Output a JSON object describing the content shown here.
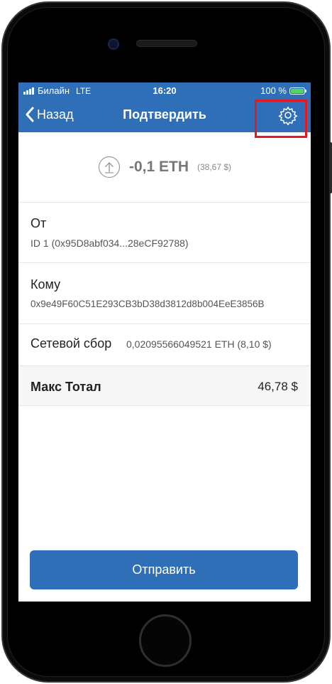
{
  "status_bar": {
    "carrier": "Билайн",
    "network": "LTE",
    "time": "16:20",
    "battery_percent": "100 %"
  },
  "nav": {
    "back_label": "Назад",
    "title": "Подтвердить",
    "settings_icon": "gear-icon"
  },
  "amount": {
    "direction_icon": "arrow-up-circle-icon",
    "value": "-0,1 ETH",
    "fiat": "(38,67 $)"
  },
  "details": {
    "from_label": "От",
    "from_value": "ID 1 (0x95D8abf034...28eCF92788)",
    "to_label": "Кому",
    "to_value": "0x9e49F60C51E293CB3bD38d3812d8b004EeE3856B",
    "fee_label": "Сетевой сбор",
    "fee_value": "0,02095566049521 ETH (8,10 $)",
    "total_label": "Макс Тотал",
    "total_value": "46,78 $"
  },
  "actions": {
    "send_label": "Отправить"
  },
  "colors": {
    "accent": "#2f6fb8",
    "highlight": "#e01b24",
    "battery": "#4cd964"
  }
}
